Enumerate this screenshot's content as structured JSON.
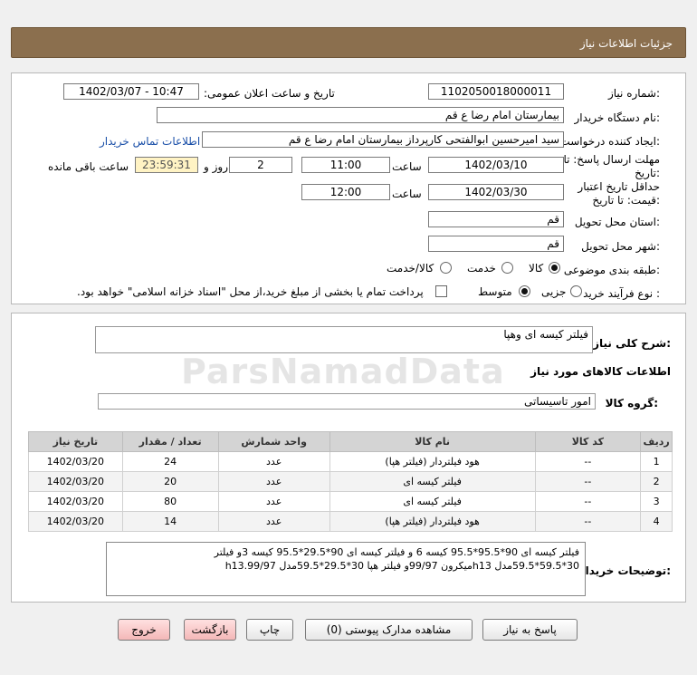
{
  "header": {
    "title": "جزئیات اطلاعات نیاز"
  },
  "form": {
    "need_number_label": "شماره نیاز:",
    "need_number": "1102050018000011",
    "announce_label": "تاریخ و ساعت اعلان عمومی:",
    "announce_value": "1402/03/07 - 10:47",
    "buyer_label": "نام دستگاه خریدار:",
    "buyer_value": "بیمارستان امام رضا ع  قم",
    "creator_label": "ایجاد کننده درخواست:",
    "creator_value": "سید امیرحسین ابوالفتحی کارپرداز بیمارستان امام رضا ع  قم",
    "contact_link": "اطلاعات تماس خریدار",
    "deadline_label_1": "مهلت ارسال پاسخ: تا",
    "deadline_label_2": "تاریخ:",
    "deadline_date": "1402/03/10",
    "time_label": "ساعت",
    "deadline_time": "11:00",
    "days_value": "2",
    "days_label": "روز و",
    "remaining_time": "23:59:31",
    "remaining_label": "ساعت باقی مانده",
    "validity_label_1": "حداقل تاریخ اعتبار",
    "validity_label_2": "قیمت: تا تاریخ:",
    "validity_date": "1402/03/30",
    "validity_time_label": "ساعت",
    "validity_time": "12:00",
    "province_label": "استان محل تحویل:",
    "province_value": "قم",
    "city_label": "شهر محل تحویل:",
    "city_value": "قم",
    "category_label": "طبقه بندی موضوعی:",
    "category_options": [
      "کالا",
      "خدمت",
      "کالا/خدمت"
    ],
    "category_selected": "کالا",
    "process_label": "نوع فرآیند خرید :",
    "process_options": [
      "جزیی",
      "متوسط"
    ],
    "process_selected": "متوسط",
    "payment_note": "پرداخت تمام یا بخشی از مبلغ خرید،از محل \"اسناد خزانه اسلامی\" خواهد بود."
  },
  "details": {
    "summary_label": "شرح کلی نیاز:",
    "summary_value": "فیلتر کیسه ای وهپا",
    "goods_info_title": "اطلاعات کالاهای مورد نیاز",
    "group_label": "گروه کالا:",
    "group_value": "امور تاسیساتی",
    "table": {
      "headers": [
        "ردیف",
        "کد کالا",
        "نام کالا",
        "واحد شمارش",
        "تعداد / مقدار",
        "تاریخ نیاز"
      ],
      "rows": [
        [
          "1",
          "--",
          "هود فیلتردار (فیلتر هپا)",
          "عدد",
          "24",
          "1402/03/20"
        ],
        [
          "2",
          "--",
          "فیلتر کیسه ای",
          "عدد",
          "20",
          "1402/03/20"
        ],
        [
          "3",
          "--",
          "فیلتر کیسه ای",
          "عدد",
          "80",
          "1402/03/20"
        ],
        [
          "4",
          "--",
          "هود فیلتردار (فیلتر هپا)",
          "عدد",
          "14",
          "1402/03/20"
        ]
      ]
    },
    "buyer_notes_label": "توضیحات خریدار:",
    "buyer_notes_line1": "فیلتر کیسه ای 90*95.5*95.5 کیسه 6 و   فیلتر کیسه ای 90*29.5*95.5 کیسه 3و   فیلتر",
    "buyer_notes_line2": "30*59.5*59.5مدل h13میکرون 99/97و   فیلتر هپا 30*29.5*59.5مدل h13.99/97"
  },
  "buttons": {
    "reply": "پاسخ به نیاز",
    "attachments": "مشاهده مدارک پیوستی (0)",
    "print": "چاپ",
    "back": "بازگشت",
    "exit": "خروج"
  },
  "watermark": "ParsNamadData"
}
